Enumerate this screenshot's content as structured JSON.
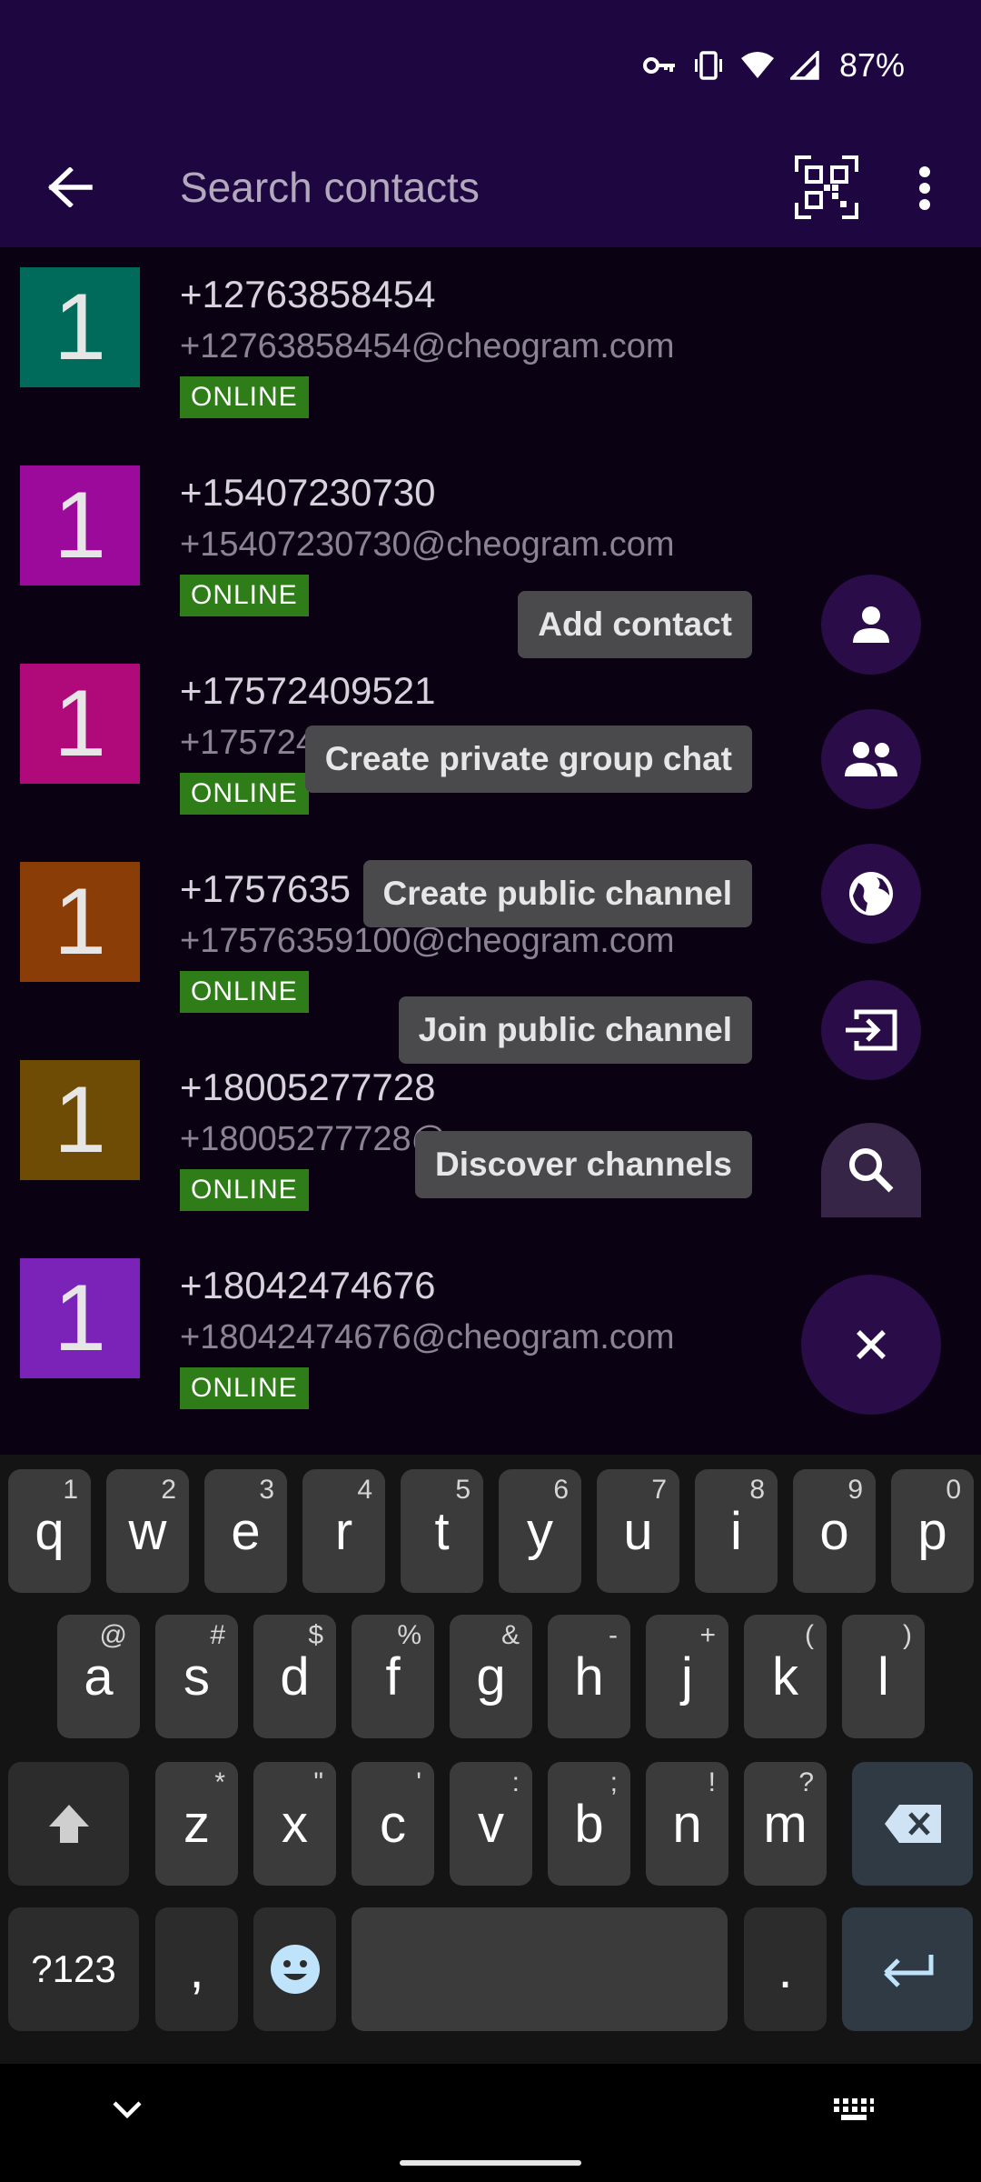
{
  "status_bar": {
    "battery": "87%",
    "icons": [
      "vpn-key-icon",
      "vibrate-icon",
      "wifi-icon",
      "signal-icon"
    ]
  },
  "app_bar": {
    "back_icon": "arrow-back-icon",
    "search_placeholder": "Search contacts",
    "qr_icon": "qr-code-icon",
    "more_icon": "more-vert-icon"
  },
  "contacts": [
    {
      "avatar_letter": "1",
      "avatar_color": "#006b5a",
      "name": "+12763858454",
      "jid": "+12763858454@cheogram.com",
      "status": "ONLINE"
    },
    {
      "avatar_letter": "1",
      "avatar_color": "#9c0a9c",
      "name": "+15407230730",
      "jid": "+15407230730@cheogram.com",
      "status": "ONLINE"
    },
    {
      "avatar_letter": "1",
      "avatar_color": "#b00a7a",
      "name": "+17572409521",
      "jid": "+1757240",
      "status": "ONLINE"
    },
    {
      "avatar_letter": "1",
      "avatar_color": "#8a3d06",
      "name": "+1757635",
      "jid": "+17576359100@cheogram.com",
      "status": "ONLINE"
    },
    {
      "avatar_letter": "1",
      "avatar_color": "#6e4c06",
      "name": "+18005277728",
      "jid": "+18005277728@c",
      "status": "ONLINE"
    },
    {
      "avatar_letter": "1",
      "avatar_color": "#7b22b8",
      "name": "+18042474676",
      "jid": "+18042474676@cheogram.com",
      "status": "ONLINE"
    }
  ],
  "speed_dial": {
    "items": [
      {
        "label": "Add contact",
        "icon": "person-icon"
      },
      {
        "label": "Create private group chat",
        "icon": "group-icon"
      },
      {
        "label": "Create public channel",
        "icon": "globe-icon"
      },
      {
        "label": "Join public channel",
        "icon": "input-icon"
      },
      {
        "label": "Discover channels",
        "icon": "search-icon"
      }
    ],
    "close_icon": "close-icon"
  },
  "keyboard": {
    "row1": [
      {
        "key": "q",
        "hint": "1"
      },
      {
        "key": "w",
        "hint": "2"
      },
      {
        "key": "e",
        "hint": "3"
      },
      {
        "key": "r",
        "hint": "4"
      },
      {
        "key": "t",
        "hint": "5"
      },
      {
        "key": "y",
        "hint": "6"
      },
      {
        "key": "u",
        "hint": "7"
      },
      {
        "key": "i",
        "hint": "8"
      },
      {
        "key": "o",
        "hint": "9"
      },
      {
        "key": "p",
        "hint": "0"
      }
    ],
    "row2": [
      {
        "key": "a",
        "hint": "@"
      },
      {
        "key": "s",
        "hint": "#"
      },
      {
        "key": "d",
        "hint": "$"
      },
      {
        "key": "f",
        "hint": "%"
      },
      {
        "key": "g",
        "hint": "&"
      },
      {
        "key": "h",
        "hint": "-"
      },
      {
        "key": "j",
        "hint": "+"
      },
      {
        "key": "k",
        "hint": "("
      },
      {
        "key": "l",
        "hint": ")"
      }
    ],
    "row3": [
      {
        "key": "z",
        "hint": "*"
      },
      {
        "key": "x",
        "hint": "\""
      },
      {
        "key": "c",
        "hint": "'"
      },
      {
        "key": "v",
        "hint": ":"
      },
      {
        "key": "b",
        "hint": ";"
      },
      {
        "key": "n",
        "hint": "!"
      },
      {
        "key": "m",
        "hint": "?"
      }
    ],
    "symbols_key": "?123",
    "comma_key": ",",
    "period_key": ".",
    "shift_icon": "shift-icon",
    "backspace_icon": "backspace-icon",
    "emoji_icon": "emoji-icon",
    "enter_icon": "enter-icon"
  },
  "nav_bar": {
    "hide_keyboard_icon": "chevron-down-icon",
    "keyboard_switch_icon": "keyboard-icon"
  }
}
